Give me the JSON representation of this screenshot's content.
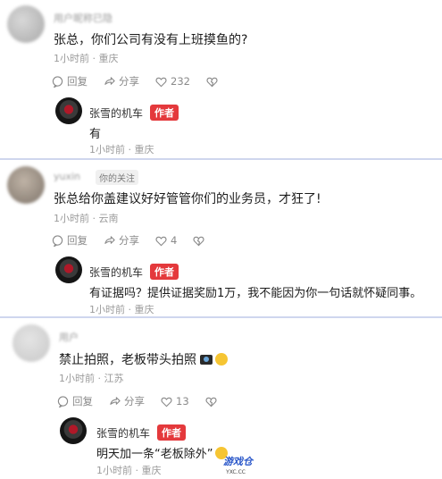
{
  "comments": [
    {
      "username": "用户昵称已隐",
      "text": "张总，你们公司有没有上班摸鱼的?",
      "time": "1小时前",
      "location": "重庆",
      "reply_label": "回复",
      "share_label": "分享",
      "likes": "232",
      "reply": {
        "author": "张雪的机车",
        "badge": "作者",
        "text": "有",
        "time": "1小时前",
        "location": "重庆"
      }
    },
    {
      "username": "yuxin",
      "follow_tag": "你的关注",
      "text": "张总给你盖建议好好管管你们的业务员，才狂了!",
      "time": "1小时前",
      "location": "云南",
      "reply_label": "回复",
      "share_label": "分享",
      "likes": "4",
      "reply": {
        "author": "张雪的机车",
        "badge": "作者",
        "text": "有证据吗？提供证据奖励1万，我不能因为你一句话就怀疑同事。",
        "time": "1小时前",
        "location": "重庆"
      }
    },
    {
      "username": "用户",
      "text": "禁止拍照，老板带头拍照",
      "time": "1小时前",
      "location": "江苏",
      "reply_label": "回复",
      "share_label": "分享",
      "likes": "13",
      "reply": {
        "author": "张雪的机车",
        "badge": "作者",
        "text": "明天加一条“老板除外”",
        "time": "1小时前",
        "location": "重庆"
      }
    }
  ],
  "separator": " · ",
  "watermark": {
    "main": "游戏仓",
    "sub": "YXC.CC"
  },
  "colors": {
    "badge": "#e4393c",
    "divider": "#cfd6ee"
  }
}
